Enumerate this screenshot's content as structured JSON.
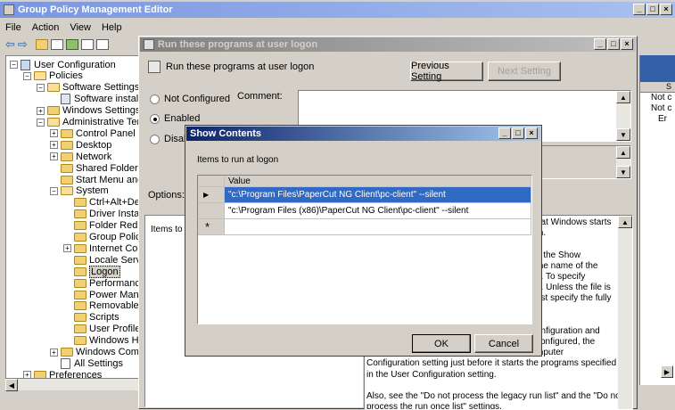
{
  "main_window": {
    "title": "Group Policy Management Editor",
    "menu": [
      "File",
      "Action",
      "View",
      "Help"
    ]
  },
  "tree": {
    "items": [
      {
        "label": "User Configuration",
        "level": 0,
        "toggle": "-"
      },
      {
        "label": "Policies",
        "level": 1,
        "toggle": "-"
      },
      {
        "label": "Software Settings",
        "level": 2,
        "toggle": "-"
      },
      {
        "label": "Software installati",
        "level": 3,
        "toggle": ""
      },
      {
        "label": "Windows Settings",
        "level": 2,
        "toggle": "+"
      },
      {
        "label": "Administrative Templa",
        "level": 2,
        "toggle": "-"
      },
      {
        "label": "Control Panel",
        "level": 3,
        "toggle": "+"
      },
      {
        "label": "Desktop",
        "level": 3,
        "toggle": "+"
      },
      {
        "label": "Network",
        "level": 3,
        "toggle": "+"
      },
      {
        "label": "Shared Folders",
        "level": 3,
        "toggle": ""
      },
      {
        "label": "Start Menu and Ta",
        "level": 3,
        "toggle": ""
      },
      {
        "label": "System",
        "level": 3,
        "toggle": "-"
      },
      {
        "label": "Ctrl+Alt+Del C",
        "level": 4,
        "toggle": ""
      },
      {
        "label": "Driver Installa",
        "level": 4,
        "toggle": ""
      },
      {
        "label": "Folder Redirect",
        "level": 4,
        "toggle": ""
      },
      {
        "label": "Group Policy",
        "level": 4,
        "toggle": ""
      },
      {
        "label": "Internet Comr",
        "level": 4,
        "toggle": "+"
      },
      {
        "label": "Locale Service",
        "level": 4,
        "toggle": ""
      },
      {
        "label": "Logon",
        "level": 4,
        "toggle": "",
        "selected": true
      },
      {
        "label": "Performance C",
        "level": 4,
        "toggle": ""
      },
      {
        "label": "Power Manage",
        "level": 4,
        "toggle": ""
      },
      {
        "label": "Removable Sto",
        "level": 4,
        "toggle": ""
      },
      {
        "label": "Scripts",
        "level": 4,
        "toggle": ""
      },
      {
        "label": "User Profiles",
        "level": 4,
        "toggle": ""
      },
      {
        "label": "Windows HotS",
        "level": 4,
        "toggle": ""
      },
      {
        "label": "Windows Compon",
        "level": 3,
        "toggle": "+"
      },
      {
        "label": "All Settings",
        "level": 3,
        "toggle": ""
      },
      {
        "label": "Preferences",
        "level": 1,
        "toggle": "+"
      }
    ]
  },
  "right_pane": {
    "rows": [
      "Not c",
      "Not c",
      "Er"
    ],
    "header_fragment": "S"
  },
  "policy_dialog": {
    "title": "Run these programs at user logon",
    "heading": "Run these programs at user logon",
    "previous_setting": "Previous Setting",
    "next_setting": "Next Setting",
    "not_configured": "Not Configured",
    "enabled": "Enabled",
    "disabled": "Disabl",
    "comment_label": "Comment:",
    "options_label": "Options:",
    "items_label": "Items to r",
    "help_lines": [
      "hat Windows starts",
      "m.",
      "",
      "n the Show",
      "the name of the",
      "e. To specify",
      "e. Unless the file is",
      "ust specify the fully",
      "",
      "",
      "onfiguration and",
      "configured, the",
      "mputer",
      "Configuration setting just before it starts the programs specified",
      "in the User Configuration setting.",
      "",
      "Also, see the \"Do not process the legacy run list\" and the \"Do not",
      "process the run once list\" settings."
    ]
  },
  "show_contents": {
    "title": "Show Contents",
    "items_label": "Items to run at logon",
    "column_header": "Value",
    "rows": [
      "\"c:\\Program Files\\PaperCut NG Client\\pc-client\" --silent",
      "\"c:\\Program Files (x86)\\PaperCut NG Client\\pc-client\" --silent"
    ],
    "new_row_marker": "*",
    "current_row_marker": "▶",
    "ok": "OK",
    "cancel": "Cancel"
  }
}
